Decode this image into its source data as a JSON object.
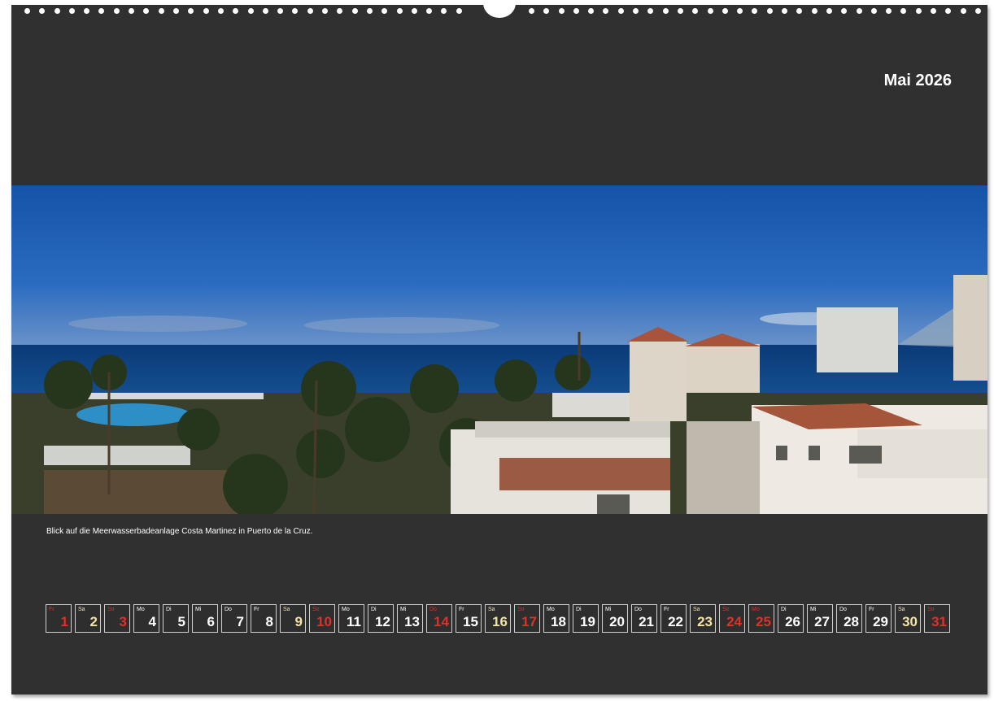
{
  "header": {
    "title": "Mai 2026"
  },
  "photo": {
    "caption": "Blick auf die Meerwasserbadeanlage Costa Martinez in Puerto de la Cruz."
  },
  "calendar": {
    "days": [
      {
        "wd": "Fr",
        "num": "1",
        "type": "red"
      },
      {
        "wd": "Sa",
        "num": "2",
        "type": "sat"
      },
      {
        "wd": "So",
        "num": "3",
        "type": "red"
      },
      {
        "wd": "Mo",
        "num": "4",
        "type": "normal"
      },
      {
        "wd": "Di",
        "num": "5",
        "type": "normal"
      },
      {
        "wd": "Mi",
        "num": "6",
        "type": "normal"
      },
      {
        "wd": "Do",
        "num": "7",
        "type": "normal"
      },
      {
        "wd": "Fr",
        "num": "8",
        "type": "normal"
      },
      {
        "wd": "Sa",
        "num": "9",
        "type": "sat"
      },
      {
        "wd": "So",
        "num": "10",
        "type": "red"
      },
      {
        "wd": "Mo",
        "num": "11",
        "type": "normal"
      },
      {
        "wd": "Di",
        "num": "12",
        "type": "normal"
      },
      {
        "wd": "Mi",
        "num": "13",
        "type": "normal"
      },
      {
        "wd": "Do",
        "num": "14",
        "type": "red"
      },
      {
        "wd": "Fr",
        "num": "15",
        "type": "normal"
      },
      {
        "wd": "Sa",
        "num": "16",
        "type": "sat"
      },
      {
        "wd": "So",
        "num": "17",
        "type": "red"
      },
      {
        "wd": "Mo",
        "num": "18",
        "type": "normal"
      },
      {
        "wd": "Di",
        "num": "19",
        "type": "normal"
      },
      {
        "wd": "Mi",
        "num": "20",
        "type": "normal"
      },
      {
        "wd": "Do",
        "num": "21",
        "type": "normal"
      },
      {
        "wd": "Fr",
        "num": "22",
        "type": "normal"
      },
      {
        "wd": "Sa",
        "num": "23",
        "type": "sat"
      },
      {
        "wd": "So",
        "num": "24",
        "type": "red"
      },
      {
        "wd": "Mo",
        "num": "25",
        "type": "red"
      },
      {
        "wd": "Di",
        "num": "26",
        "type": "normal"
      },
      {
        "wd": "Mi",
        "num": "27",
        "type": "normal"
      },
      {
        "wd": "Do",
        "num": "28",
        "type": "normal"
      },
      {
        "wd": "Fr",
        "num": "29",
        "type": "normal"
      },
      {
        "wd": "Sa",
        "num": "30",
        "type": "sat"
      },
      {
        "wd": "So",
        "num": "31",
        "type": "red"
      }
    ]
  },
  "colors": {
    "page_background": "#303030",
    "holiday_red": "#e0302a",
    "saturday": "#f3e3a6",
    "sky": "#1c5fb0",
    "sea": "#0d3a73"
  }
}
